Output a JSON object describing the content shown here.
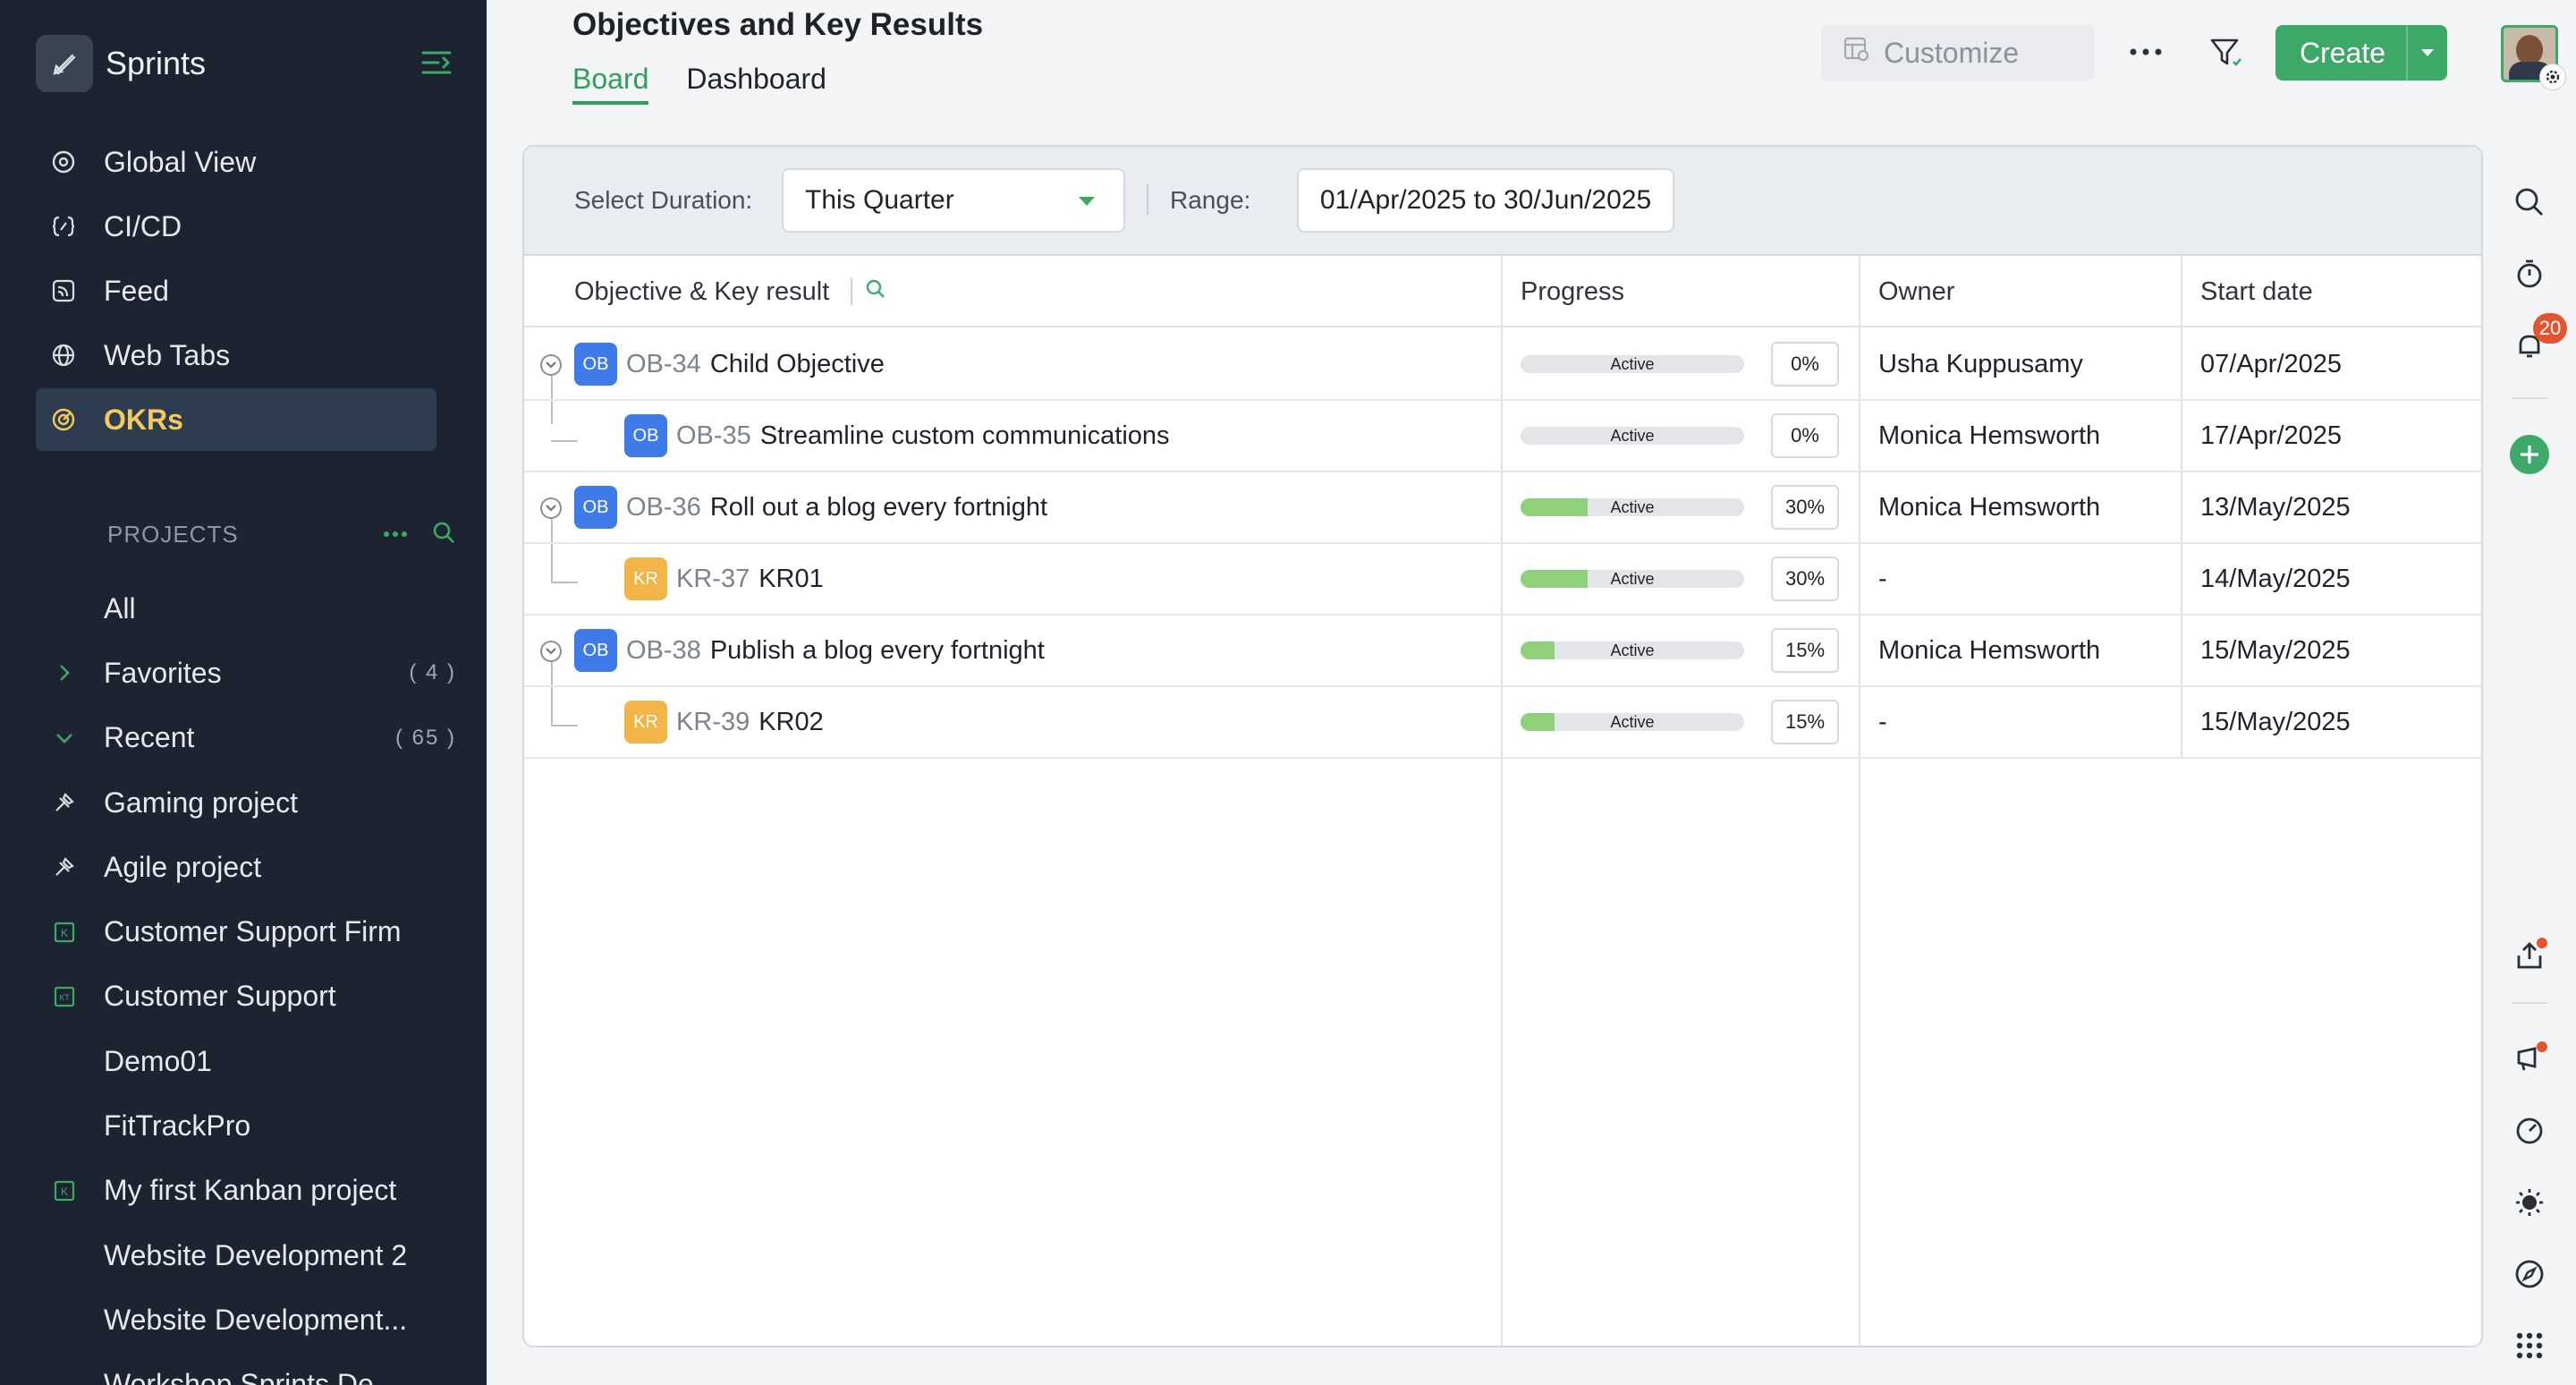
{
  "brand": {
    "name": "Sprints"
  },
  "nav": [
    {
      "label": "Global View",
      "icon": "globe-eye-icon"
    },
    {
      "label": "CI/CD",
      "icon": "cicd-icon"
    },
    {
      "label": "Feed",
      "icon": "feed-icon"
    },
    {
      "label": "Web Tabs",
      "icon": "web-tabs-icon"
    },
    {
      "label": "OKRs",
      "icon": "target-icon",
      "active": true
    }
  ],
  "projects": {
    "title": "PROJECTS",
    "items": [
      {
        "label": "All"
      },
      {
        "label": "Favorites",
        "count": "( 4 )"
      },
      {
        "label": "Recent",
        "count": "( 65 )"
      },
      {
        "label": "Gaming project"
      },
      {
        "label": "Agile project"
      },
      {
        "label": "Customer Support Firm"
      },
      {
        "label": "Customer Support"
      },
      {
        "label": "Demo01"
      },
      {
        "label": "FitTrackPro"
      },
      {
        "label": "My first Kanban project"
      },
      {
        "label": "Website Development 2"
      },
      {
        "label": "Website Development..."
      },
      {
        "label": "Workshop Sprints De..."
      }
    ]
  },
  "header": {
    "title": "Objectives and Key Results",
    "tabs": [
      "Board",
      "Dashboard"
    ],
    "customize_label": "Customize",
    "create_label": "Create"
  },
  "rail": {
    "notification_count": "20"
  },
  "filters": {
    "duration_label": "Select Duration:",
    "duration_value": "This Quarter",
    "range_label": "Range:",
    "range_value": "01/Apr/2025 to 30/Jun/2025"
  },
  "table": {
    "columns": [
      "Objective & Key result",
      "Progress",
      "Owner",
      "Start date"
    ],
    "rows": [
      {
        "type": "OB",
        "id": "OB-34",
        "title": "Child Objective",
        "status": "Active",
        "progress": 0,
        "progress_label": "0%",
        "owner": "Usha Kuppusamy",
        "start": "07/Apr/2025",
        "level": 0
      },
      {
        "type": "OB",
        "id": "OB-35",
        "title": "Streamline custom communications",
        "status": "Active",
        "progress": 0,
        "progress_label": "0%",
        "owner": "Monica Hemsworth",
        "start": "17/Apr/2025",
        "level": 1
      },
      {
        "type": "OB",
        "id": "OB-36",
        "title": "Roll out a blog every fortnight",
        "status": "Active",
        "progress": 30,
        "progress_label": "30%",
        "owner": "Monica Hemsworth",
        "start": "13/May/2025",
        "level": 0
      },
      {
        "type": "KR",
        "id": "KR-37",
        "title": "KR01",
        "status": "Active",
        "progress": 30,
        "progress_label": "30%",
        "owner": "-",
        "start": "14/May/2025",
        "level": 1
      },
      {
        "type": "OB",
        "id": "OB-38",
        "title": "Publish a blog every fortnight",
        "status": "Active",
        "progress": 15,
        "progress_label": "15%",
        "owner": "Monica Hemsworth",
        "start": "15/May/2025",
        "level": 0
      },
      {
        "type": "KR",
        "id": "KR-39",
        "title": "KR02",
        "status": "Active",
        "progress": 15,
        "progress_label": "15%",
        "owner": "-",
        "start": "15/May/2025",
        "level": 1
      }
    ]
  },
  "colors": {
    "accent": "#3ea868",
    "sidebar": "#1c2431",
    "active_nav": "#f4c95d",
    "ob_tag": "#3f7be8",
    "kr_tag": "#f3b548",
    "progress_fill": "#8fd17a"
  }
}
